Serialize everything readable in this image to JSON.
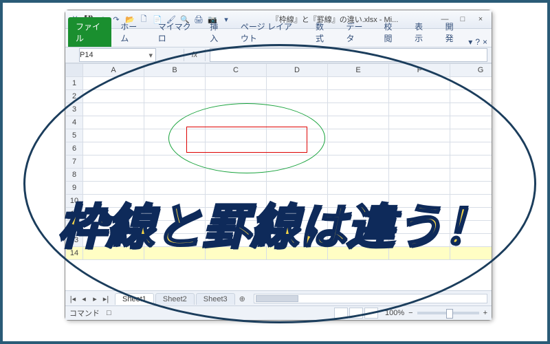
{
  "window": {
    "title": "『枠線』と『罫線』の違い.xlsx - Mi...",
    "min": "—",
    "max": "□",
    "close": "×"
  },
  "qat": {
    "excel": "X",
    "save": "💾",
    "undo": "↶",
    "redo": "↷",
    "open": "📂",
    "new": "🗋",
    "copy": "📄",
    "brush": "🖌",
    "printpv": "🔍",
    "print": "🖨",
    "camera": "📷",
    "dd": "▾"
  },
  "ribbon": {
    "file": "ファイル",
    "home": "ホーム",
    "mymacro": "マイマクロ",
    "insert": "挿入",
    "pagelayout": "ページ レイアウト",
    "formulas": "数式",
    "data": "データ",
    "review": "校閲",
    "view": "表示",
    "developer": "開発",
    "help_dd": "▾",
    "help_q": "?",
    "help_x": "×"
  },
  "namebox": {
    "value": "P14",
    "dd": "▾"
  },
  "fx_label": "fx",
  "cols": [
    "A",
    "B",
    "C",
    "D",
    "E",
    "F",
    "G"
  ],
  "rows": [
    "1",
    "2",
    "3",
    "4",
    "5",
    "6",
    "7",
    "8",
    "9",
    "10",
    "11",
    "12",
    "13",
    "14"
  ],
  "highlight_row": "14",
  "sheets": {
    "nav_first": "|◂",
    "nav_prev": "◂",
    "nav_next": "▸",
    "nav_last": "▸|",
    "s1": "Sheet1",
    "s2": "Sheet2",
    "s3": "Sheet3",
    "add": "⊕"
  },
  "status": {
    "mode": "コマンド",
    "rec": "□",
    "zoom_minus": "−",
    "zoom_pct": "100%",
    "zoom_plus": "+"
  },
  "annotation": {
    "big_text": "枠線と罫線は違う！"
  }
}
